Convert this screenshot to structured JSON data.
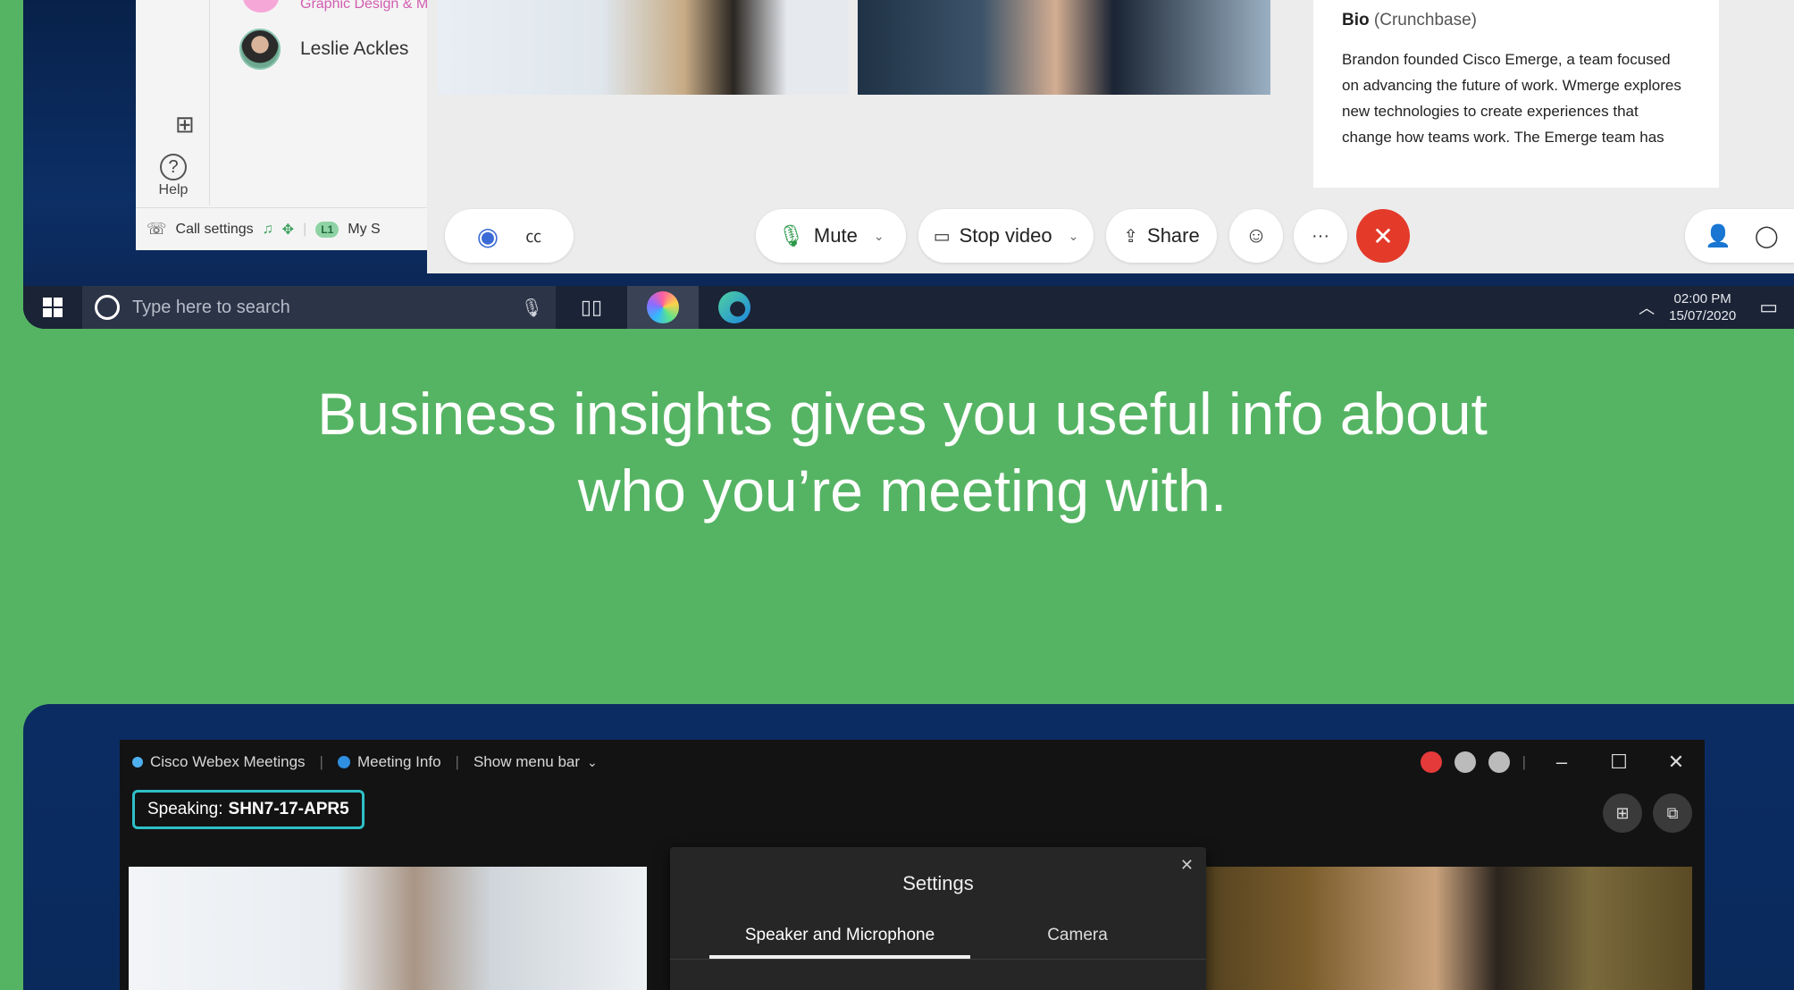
{
  "top_screenshot": {
    "teams_panel": {
      "contact_cut_label": "Graphic Design & Mar",
      "contact_name": "Leslie Ackles",
      "help_label": "Help",
      "call_settings_label": "Call settings",
      "badge": "L1",
      "my_status": "My S"
    },
    "bio": {
      "title": "Bio",
      "source": "(Crunchbase)",
      "text": "Brandon founded Cisco Emerge, a team focused on advancing the future of work. Wmerge explores new technologies to create experiences that change how teams work. The Emerge team has"
    },
    "controls": {
      "mute": "Mute",
      "stop_video": "Stop video",
      "share": "Share"
    },
    "taskbar": {
      "search_placeholder": "Type here to search",
      "time": "02:00 PM",
      "date": "15/07/2020"
    }
  },
  "caption": {
    "line1": "Business insights gives you useful info about",
    "line2": "who you’re meeting with."
  },
  "bottom_screenshot": {
    "titlebar": {
      "app_name": "Cisco Webex Meetings",
      "meeting_info": "Meeting Info",
      "show_menu_bar": "Show menu bar"
    },
    "speaking_label": "Speaking:",
    "speaking_name": "SHN7-17-APR5",
    "settings": {
      "title": "Settings",
      "tab_speaker": "Speaker and Microphone",
      "tab_camera": "Camera"
    }
  },
  "colors": {
    "background": "#55b463",
    "end_call": "#e33a2a",
    "speaking_border": "#2ec0c7"
  }
}
